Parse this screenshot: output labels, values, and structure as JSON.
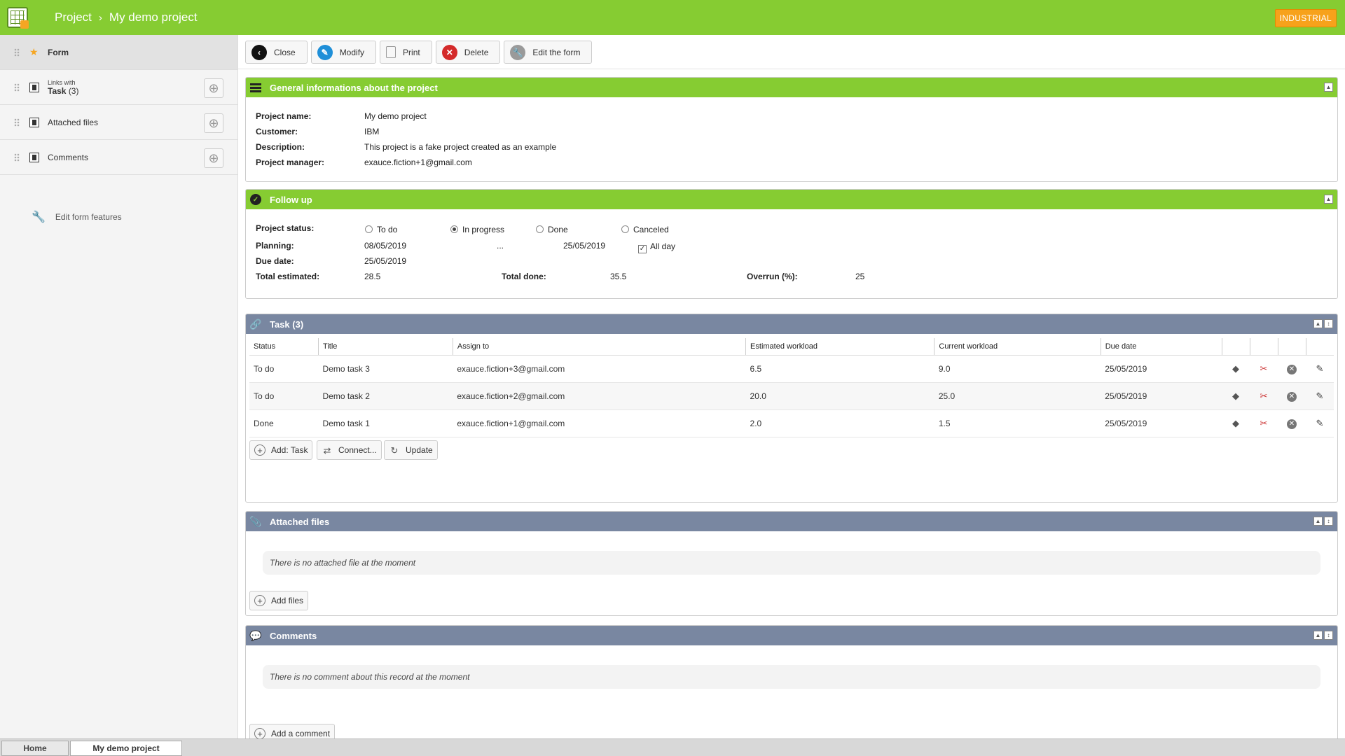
{
  "header": {
    "breadcrumb_root": "Project",
    "breadcrumb_sep": "›",
    "breadcrumb_current": "My demo project",
    "badge": "INDUSTRIAL"
  },
  "sidebar": {
    "items": [
      {
        "label": "Form"
      },
      {
        "small": "Links with",
        "label": "Task",
        "count": "(3)"
      },
      {
        "label": "Attached files"
      },
      {
        "label": "Comments"
      }
    ],
    "add_symbol": "⊕",
    "tool_label": "Edit form features"
  },
  "toolbar": {
    "close": "Close",
    "modify": "Modify",
    "print": "Print",
    "delete": "Delete",
    "edit_form": "Edit the form"
  },
  "general": {
    "title": "General informations about the project",
    "fields": [
      {
        "label": "Project name:",
        "value": "My demo project"
      },
      {
        "label": "Customer:",
        "value": "IBM"
      },
      {
        "label": "Description:",
        "value": "This project is a fake project created as an example"
      },
      {
        "label": "Project manager:",
        "value": "exauce.fiction+1@gmail.com"
      }
    ]
  },
  "followup": {
    "title": "Follow up",
    "status_label": "Project status:",
    "statuses": [
      "To do",
      "In progress",
      "Done",
      "Canceled"
    ],
    "selected_status": "In progress",
    "planning_label": "Planning:",
    "planning_start": "08/05/2019",
    "planning_sep": "...",
    "planning_end": "25/05/2019",
    "all_day_label": "All day",
    "all_day_checked": true,
    "due_label": "Due date:",
    "due_value": "25/05/2019",
    "total_estimated_label": "Total estimated:",
    "total_estimated": "28.5",
    "total_done_label": "Total done:",
    "total_done": "35.5",
    "overrun_label": "Overrun (%):",
    "overrun": "25"
  },
  "tasks": {
    "title": "Task (3)",
    "columns": [
      "Status",
      "Title",
      "Assign to",
      "Estimated workload",
      "Current workload",
      "Due date"
    ],
    "rows": [
      {
        "status": "To do",
        "title": "Demo task 3",
        "assign": "exauce.fiction+3@gmail.com",
        "estimated": "6.5",
        "current": "9.0",
        "due": "25/05/2019"
      },
      {
        "status": "To do",
        "title": "Demo task 2",
        "assign": "exauce.fiction+2@gmail.com",
        "estimated": "20.0",
        "current": "25.0",
        "due": "25/05/2019"
      },
      {
        "status": "Done",
        "title": "Demo task 1",
        "assign": "exauce.fiction+1@gmail.com",
        "estimated": "2.0",
        "current": "1.5",
        "due": "25/05/2019"
      }
    ],
    "add_label": "Add: Task",
    "connect_label": "Connect...",
    "update_label": "Update"
  },
  "files": {
    "title": "Attached files",
    "empty": "There is no attached file at the moment",
    "add_label": "Add files"
  },
  "comments": {
    "title": "Comments",
    "empty": "There is no comment about this record at the moment",
    "add_label": "Add a comment"
  },
  "bottom_tabs": [
    "Home",
    "My demo project"
  ],
  "colors": {
    "accent_green": "#86cc32",
    "panel_grey": "#7987a1",
    "badge_orange": "#f7a21b"
  }
}
